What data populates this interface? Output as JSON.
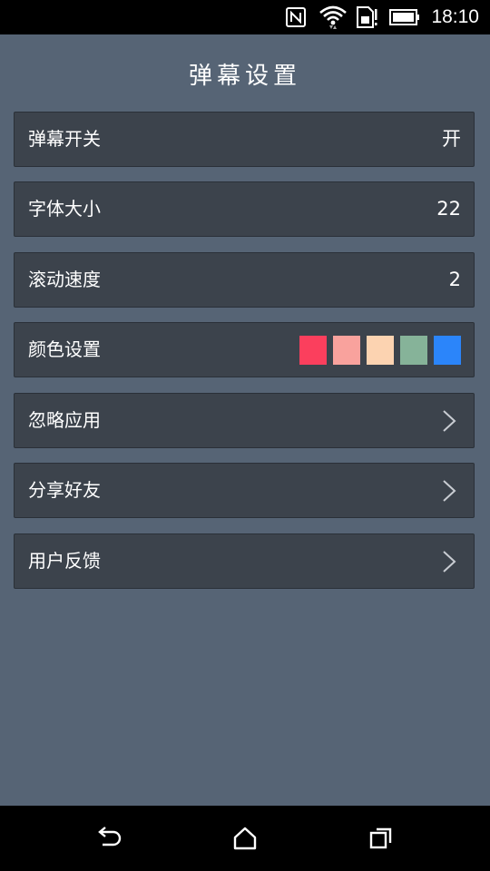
{
  "status_bar": {
    "time": "18:10",
    "icons": [
      "nfc-icon",
      "wifi-icon",
      "sim-icon",
      "battery-icon"
    ]
  },
  "page": {
    "title": "弹幕设置"
  },
  "settings": {
    "danmaku_switch": {
      "label": "弹幕开关",
      "value": "开"
    },
    "font_size": {
      "label": "字体大小",
      "value": "22"
    },
    "scroll_speed": {
      "label": "滚动速度",
      "value": "2"
    },
    "color": {
      "label": "颜色设置",
      "swatches": [
        "#fb3f5d",
        "#f9a29d",
        "#fcd3b1",
        "#86b399",
        "#2b85fa"
      ]
    },
    "ignore_apps": {
      "label": "忽略应用",
      "icon": "chevron-right-icon"
    },
    "share_friends": {
      "label": "分享好友",
      "icon": "chevron-right-icon"
    },
    "feedback": {
      "label": "用户反馈",
      "icon": "chevron-right-icon"
    }
  },
  "nav_bar": {
    "icons": [
      "back-icon",
      "home-icon",
      "recents-icon"
    ]
  }
}
